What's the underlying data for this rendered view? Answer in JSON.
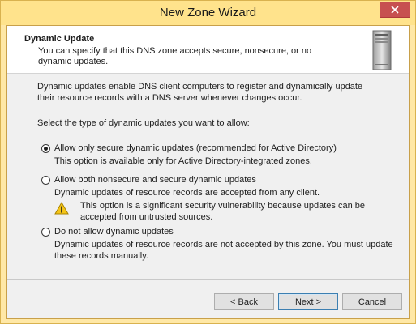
{
  "window": {
    "title": "New Zone Wizard"
  },
  "header": {
    "title": "Dynamic Update",
    "description": "You can specify that this DNS zone accepts secure, nonsecure, or no dynamic updates."
  },
  "body": {
    "intro": "Dynamic updates enable DNS client computers to register and dynamically update their resource records with a DNS server whenever changes occur.",
    "prompt": "Select the type of dynamic updates you want to allow:",
    "options": [
      {
        "label": "Allow only secure dynamic updates (recommended for Active Directory)",
        "description": "This option is available only for Active Directory-integrated zones.",
        "selected": true
      },
      {
        "label": "Allow both nonsecure and secure dynamic updates",
        "description": "Dynamic updates of resource records are accepted from any client.",
        "selected": false
      },
      {
        "label": "Do not allow dynamic updates",
        "description": "Dynamic updates of resource records are not accepted by this zone. You must update these records manually.",
        "selected": false
      }
    ],
    "warning": "This option is a significant security vulnerability because updates can be accepted from untrusted sources."
  },
  "buttons": {
    "back": "< Back",
    "next": "Next >",
    "cancel": "Cancel"
  },
  "colors": {
    "title_bar": "#ffe38c",
    "close_button": "#c75050",
    "dialog_bg": "#f0f0f0",
    "default_button_border": "#3c7fb1"
  },
  "icons": {
    "close": "close-icon",
    "server": "server-icon",
    "warning": "warning-icon"
  }
}
